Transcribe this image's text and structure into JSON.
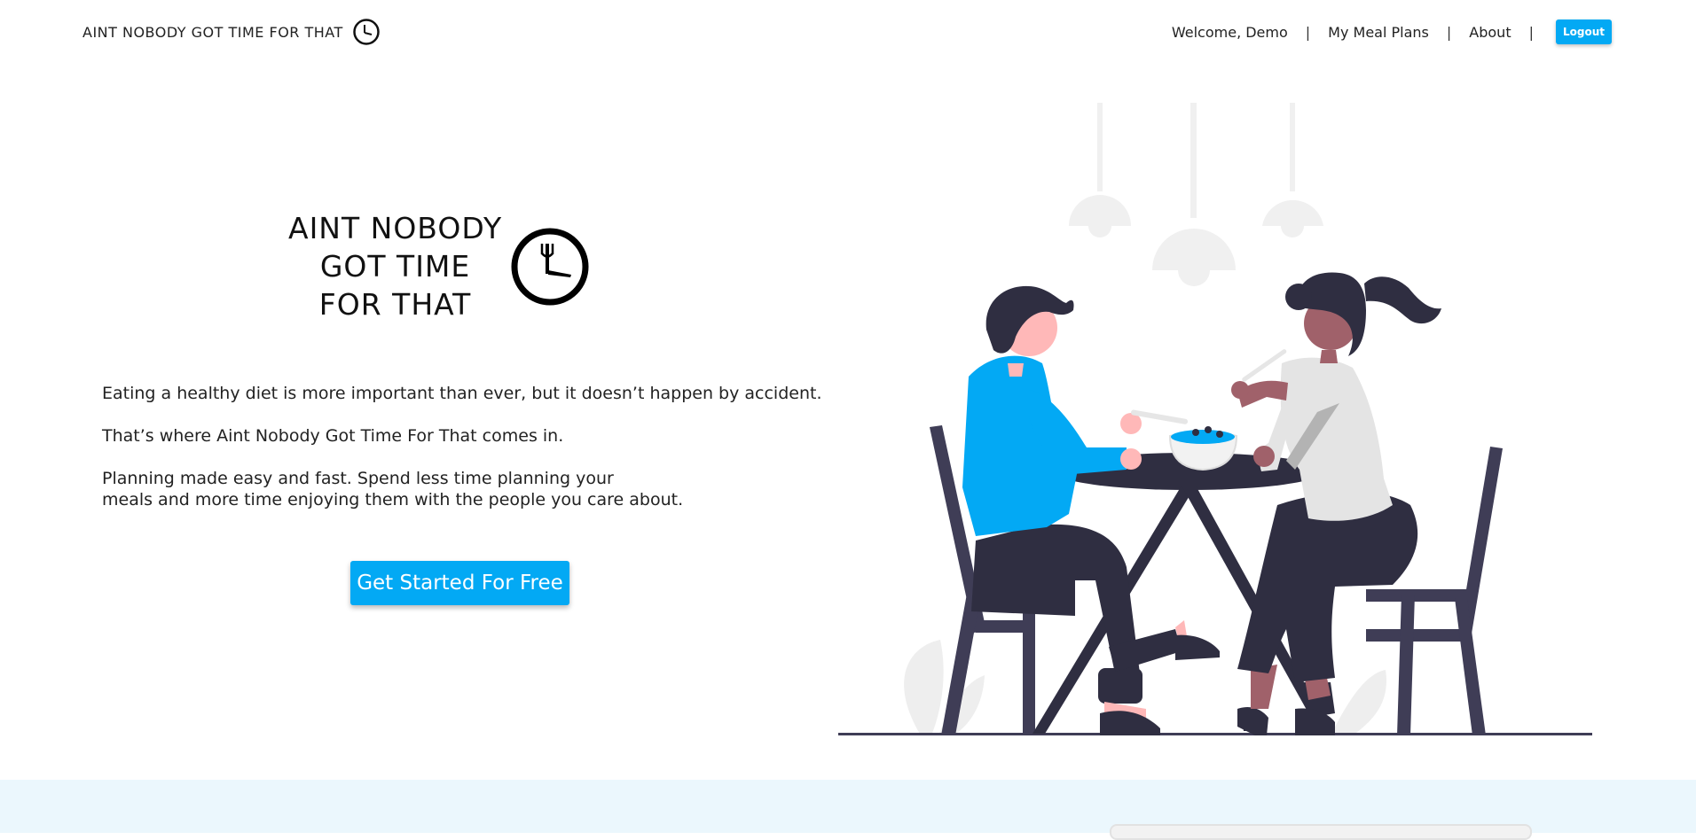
{
  "nav": {
    "brand": "AINT NOBODY GOT TIME FOR THAT",
    "welcome": "Welcome, Demo",
    "sep": "|",
    "meal_plans": "My Meal Plans",
    "about": "About",
    "logout": "Logout"
  },
  "hero": {
    "title_lines": [
      "AINT NOBODY",
      "GOT TIME",
      "FOR THAT"
    ],
    "paragraph1": "Eating a healthy diet is more important than ever, but it doesn’t happen by accident.",
    "paragraph2": "That’s where Aint Nobody Got Time For That comes in.",
    "paragraph3_line1": "Planning made easy and fast. Spend less time planning your",
    "paragraph3_line2": "meals and more time enjoying them with the people you care about.",
    "cta": "Get Started For Free"
  },
  "colors": {
    "accent": "#03a9f4",
    "band": "#ebf7fd",
    "dark": "#2f2e41"
  },
  "icons": {
    "brand": "clock-icon",
    "hero": "clock-fork-knife-icon",
    "illustration": "couple-dining-illustration"
  }
}
